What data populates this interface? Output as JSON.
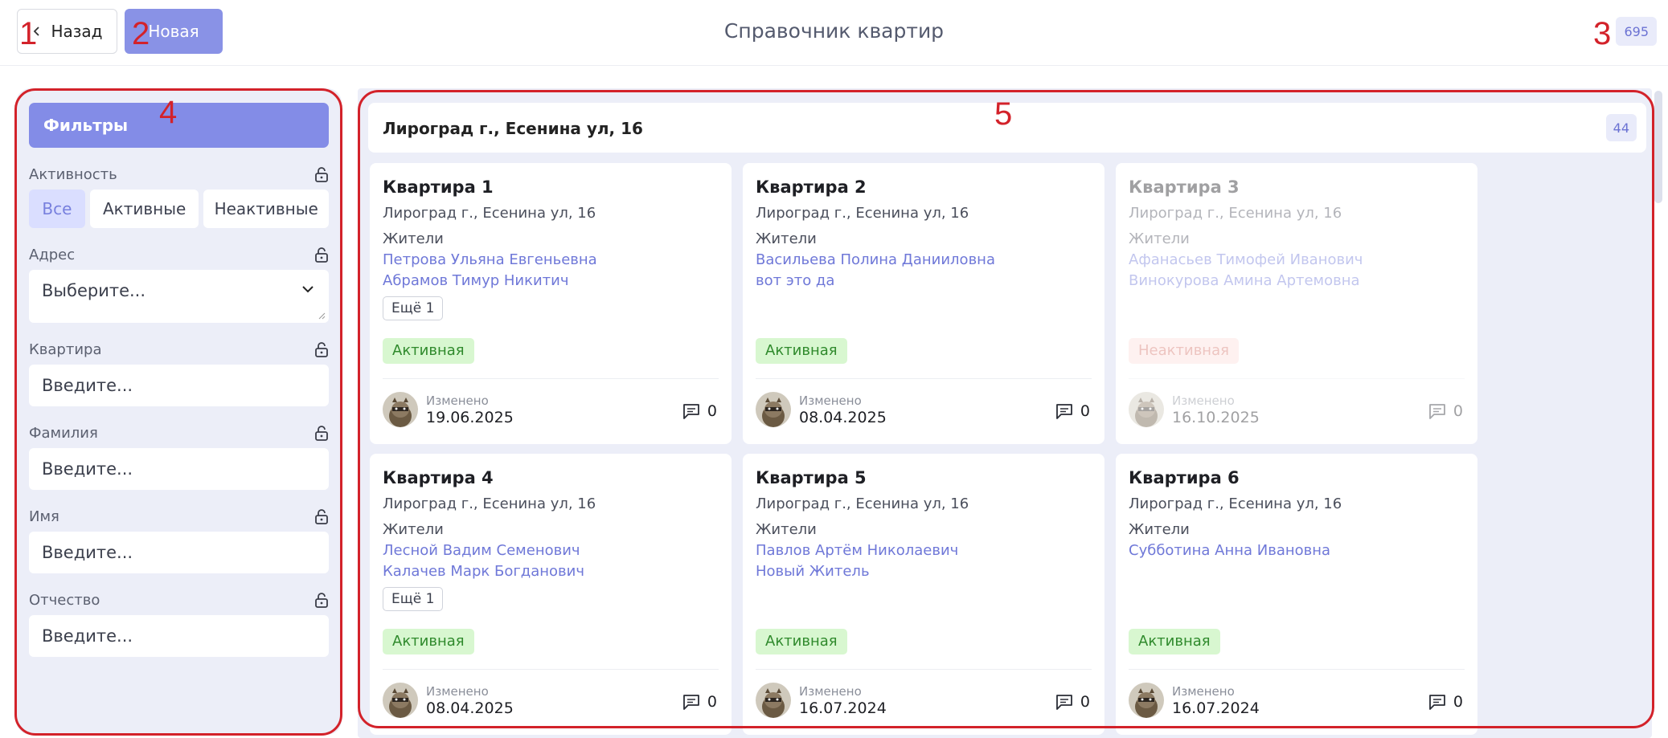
{
  "header": {
    "back_label": "Назад",
    "new_label": "Новая",
    "title": "Справочник квартир",
    "total_count": "695"
  },
  "annotations": [
    "1",
    "2",
    "3",
    "4",
    "5"
  ],
  "filters": {
    "title": "Фильтры",
    "activity": {
      "label": "Активность",
      "options": [
        "Все",
        "Активные",
        "Неактивные"
      ],
      "selected": "Все"
    },
    "address": {
      "label": "Адрес",
      "placeholder": "Выберите..."
    },
    "apartment": {
      "label": "Квартира",
      "placeholder": "Введите..."
    },
    "surname": {
      "label": "Фамилия",
      "placeholder": "Введите..."
    },
    "name": {
      "label": "Имя",
      "placeholder": "Введите..."
    },
    "patronymic": {
      "label": "Отчество",
      "placeholder": "Введите..."
    }
  },
  "group": {
    "title": "Лироград г., Есенина ул, 16",
    "count": "44"
  },
  "common": {
    "residents_label": "Жители",
    "modified_label": "Изменено"
  },
  "cards": [
    {
      "title": "Квартира 1",
      "address": "Лироград г., Есенина ул, 16",
      "residents": [
        "Петрова Ульяна Евгеньевна",
        "Абрамов Тимур Никитич"
      ],
      "more": "Ещё 1",
      "status": "Активная",
      "active": true,
      "modified": "19.06.2025",
      "comments": "0"
    },
    {
      "title": "Квартира 2",
      "address": "Лироград г., Есенина ул, 16",
      "residents": [
        "Васильева Полина Данииловна",
        "вот это да"
      ],
      "more": "",
      "status": "Активная",
      "active": true,
      "modified": "08.04.2025",
      "comments": "0"
    },
    {
      "title": "Квартира 3",
      "address": "Лироград г., Есенина ул, 16",
      "residents": [
        "Афанасьев Тимофей Иванович",
        "Винокурова Амина Артемовна"
      ],
      "more": "",
      "status": "Неактивная",
      "active": false,
      "modified": "16.10.2025",
      "comments": "0"
    },
    {
      "title": "Квартира 4",
      "address": "Лироград г., Есенина ул, 16",
      "residents": [
        "Лесной Вадим Семенович",
        "Калачев Марк Богданович"
      ],
      "more": "Ещё 1",
      "status": "Активная",
      "active": true,
      "modified": "08.04.2025",
      "comments": "0"
    },
    {
      "title": "Квартира 5",
      "address": "Лироград г., Есенина ул, 16",
      "residents": [
        "Павлов Артём Николаевич",
        "Новый Житель"
      ],
      "more": "",
      "status": "Активная",
      "active": true,
      "modified": "16.07.2024",
      "comments": "0"
    },
    {
      "title": "Квартира 6",
      "address": "Лироград г., Есенина ул, 16",
      "residents": [
        "Субботина Анна Ивановна"
      ],
      "more": "",
      "status": "Активная",
      "active": true,
      "modified": "16.07.2024",
      "comments": "0"
    }
  ],
  "colors": {
    "accent": "#838ce7",
    "panel_bg": "#eceef8",
    "annotation": "#d3222a",
    "active_bg": "#d8f7d0",
    "inactive_bg": "#fde0dd"
  }
}
